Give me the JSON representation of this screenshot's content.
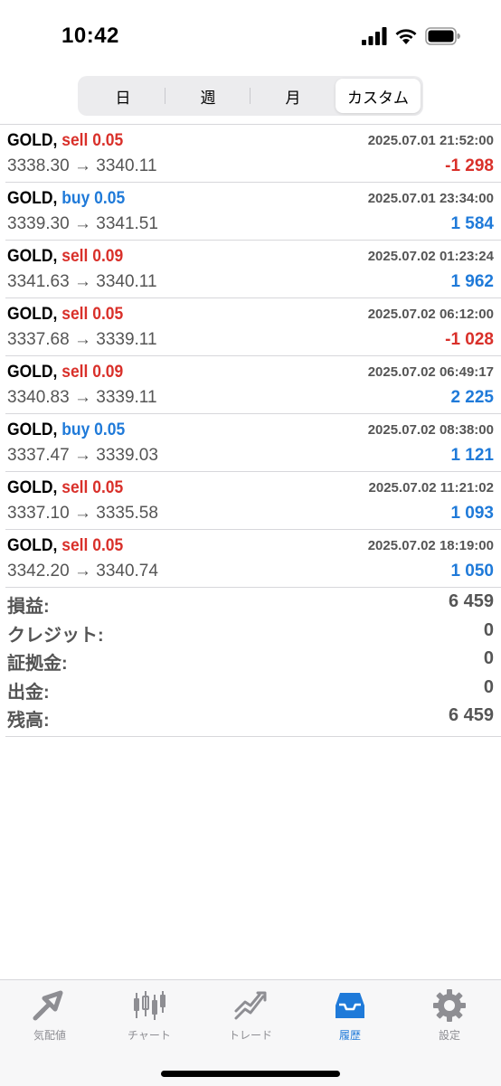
{
  "status_bar": {
    "time": "10:42"
  },
  "period_tabs": [
    {
      "label": "日",
      "active": false
    },
    {
      "label": "週",
      "active": false
    },
    {
      "label": "月",
      "active": false
    },
    {
      "label": "カスタム",
      "active": true
    }
  ],
  "trades": [
    {
      "symbol": "GOLD,",
      "type": "sell 0.05",
      "side": "sell",
      "time": "2025.07.01 21:52:00",
      "open": "3338.30",
      "close": "3340.11",
      "arrow": "→",
      "profit": "-1 298",
      "negative": true
    },
    {
      "symbol": "GOLD,",
      "type": "buy 0.05",
      "side": "buy",
      "time": "2025.07.01 23:34:00",
      "open": "3339.30",
      "close": "3341.51",
      "arrow": "→",
      "profit": "1 584",
      "negative": false
    },
    {
      "symbol": "GOLD,",
      "type": "sell 0.09",
      "side": "sell",
      "time": "2025.07.02 01:23:24",
      "open": "3341.63",
      "close": "3340.11",
      "arrow": "→",
      "profit": "1 962",
      "negative": false
    },
    {
      "symbol": "GOLD,",
      "type": "sell 0.05",
      "side": "sell",
      "time": "2025.07.02 06:12:00",
      "open": "3337.68",
      "close": "3339.11",
      "arrow": "→",
      "profit": "-1 028",
      "negative": true
    },
    {
      "symbol": "GOLD,",
      "type": "sell 0.09",
      "side": "sell",
      "time": "2025.07.02 06:49:17",
      "open": "3340.83",
      "close": "3339.11",
      "arrow": "→",
      "profit": "2 225",
      "negative": false
    },
    {
      "symbol": "GOLD,",
      "type": "buy 0.05",
      "side": "buy",
      "time": "2025.07.02 08:38:00",
      "open": "3337.47",
      "close": "3339.03",
      "arrow": "→",
      "profit": "1 121",
      "negative": false
    },
    {
      "symbol": "GOLD,",
      "type": "sell 0.05",
      "side": "sell",
      "time": "2025.07.02 11:21:02",
      "open": "3337.10",
      "close": "3335.58",
      "arrow": "→",
      "profit": "1 093",
      "negative": false
    },
    {
      "symbol": "GOLD,",
      "type": "sell 0.05",
      "side": "sell",
      "time": "2025.07.02 18:19:00",
      "open": "3342.20",
      "close": "3340.74",
      "arrow": "→",
      "profit": "1 050",
      "negative": false
    }
  ],
  "summary": [
    {
      "label": "損益:",
      "value": "6 459"
    },
    {
      "label": "クレジット:",
      "value": "0"
    },
    {
      "label": "証拠金:",
      "value": "0"
    },
    {
      "label": "出金:",
      "value": "0"
    },
    {
      "label": "残高:",
      "value": "6 459"
    }
  ],
  "tab_bar": [
    {
      "label": "気配値",
      "icon": "quotes-icon",
      "active": false
    },
    {
      "label": "チャート",
      "icon": "chart-icon",
      "active": false
    },
    {
      "label": "トレード",
      "icon": "trade-icon",
      "active": false
    },
    {
      "label": "履歴",
      "icon": "history-icon",
      "active": true
    },
    {
      "label": "設定",
      "icon": "settings-icon",
      "active": false
    }
  ],
  "colors": {
    "sell": "#d9302a",
    "buy": "#1f7ad9",
    "negative": "#d9302a",
    "positive": "#1f7ad9",
    "active_tab": "#1f7ad9",
    "inactive_tab": "#8e8e93"
  }
}
